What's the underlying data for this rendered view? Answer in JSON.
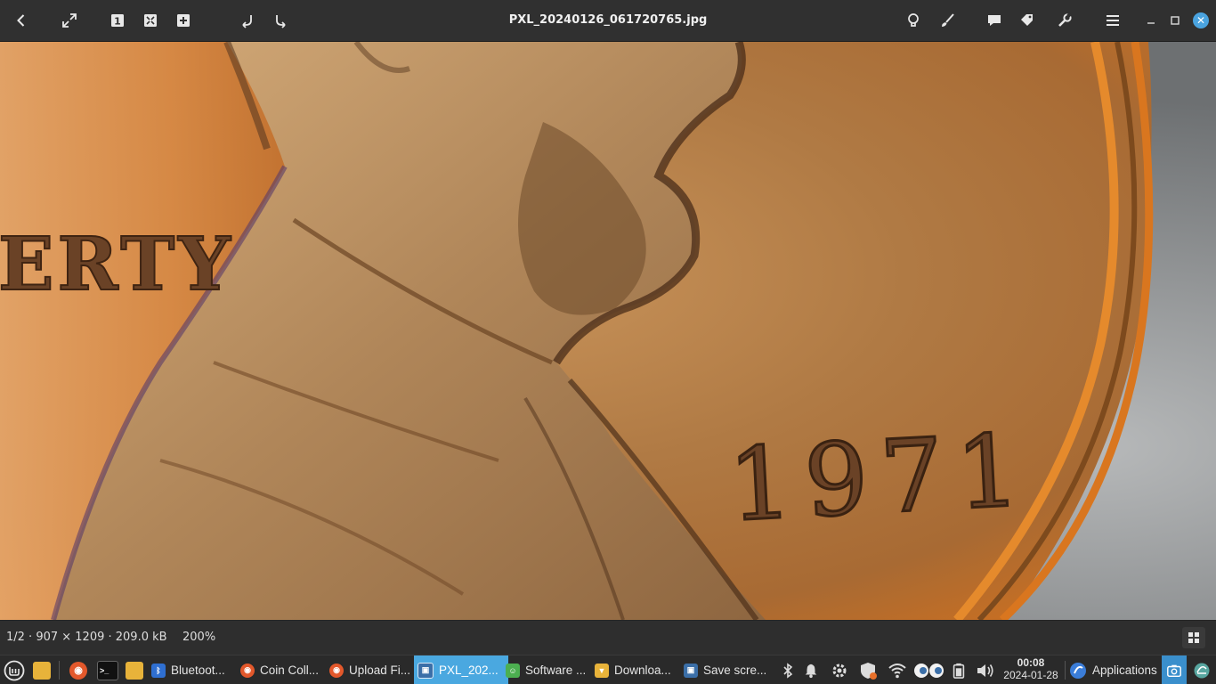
{
  "window": {
    "title": "PXL_20240126_061720765.jpg"
  },
  "toolbar": {
    "left_icons": [
      "back-arrow-icon",
      "fullscreen-icon",
      "zoom-original-icon",
      "zoom-fit-icon",
      "zoom-in-icon",
      "rotate-left-icon",
      "rotate-right-icon"
    ],
    "zoom_original_glyph": "1",
    "right_icons": [
      "lightbulb-icon",
      "brush-icon",
      "comment-icon",
      "tag-icon",
      "wrench-icon",
      "hamburger-menu-icon"
    ]
  },
  "image": {
    "visible_text_1": "ERTY",
    "visible_text_2": "1971"
  },
  "status": {
    "info": "1/2 · 907 × 1209 · 209.0 kB",
    "zoom": "200%"
  },
  "taskbar": {
    "tasks": [
      {
        "label": "Bluetoot...",
        "icon": "bluetooth-icon",
        "color": "#2f6fd1",
        "glyph": "ᛒ"
      },
      {
        "label": "Coin Coll...",
        "icon": "firefox-icon",
        "color": "#e3582b",
        "glyph": "◉"
      },
      {
        "label": "Upload Fi...",
        "icon": "firefox-icon",
        "color": "#e3582b",
        "glyph": "◉"
      },
      {
        "label": "PXL_202...",
        "icon": "image-viewer-icon",
        "color": "#3b6fa8",
        "glyph": "▣",
        "active": true
      },
      {
        "label": "Software ...",
        "icon": "software-manager-icon",
        "color": "#4caf50",
        "glyph": "☺"
      },
      {
        "label": "Downloa...",
        "icon": "folder-icon",
        "color": "#e8b33a",
        "glyph": "▼"
      },
      {
        "label": "Save scre...",
        "icon": "screenshot-icon",
        "color": "#3b6fa8",
        "glyph": "▣"
      }
    ],
    "clock_time": "00:08",
    "clock_date": "2024-01-28",
    "applications_label": "Applications",
    "colors": {
      "active": "#4aa8e0",
      "bar": "#2a2a2a"
    }
  }
}
